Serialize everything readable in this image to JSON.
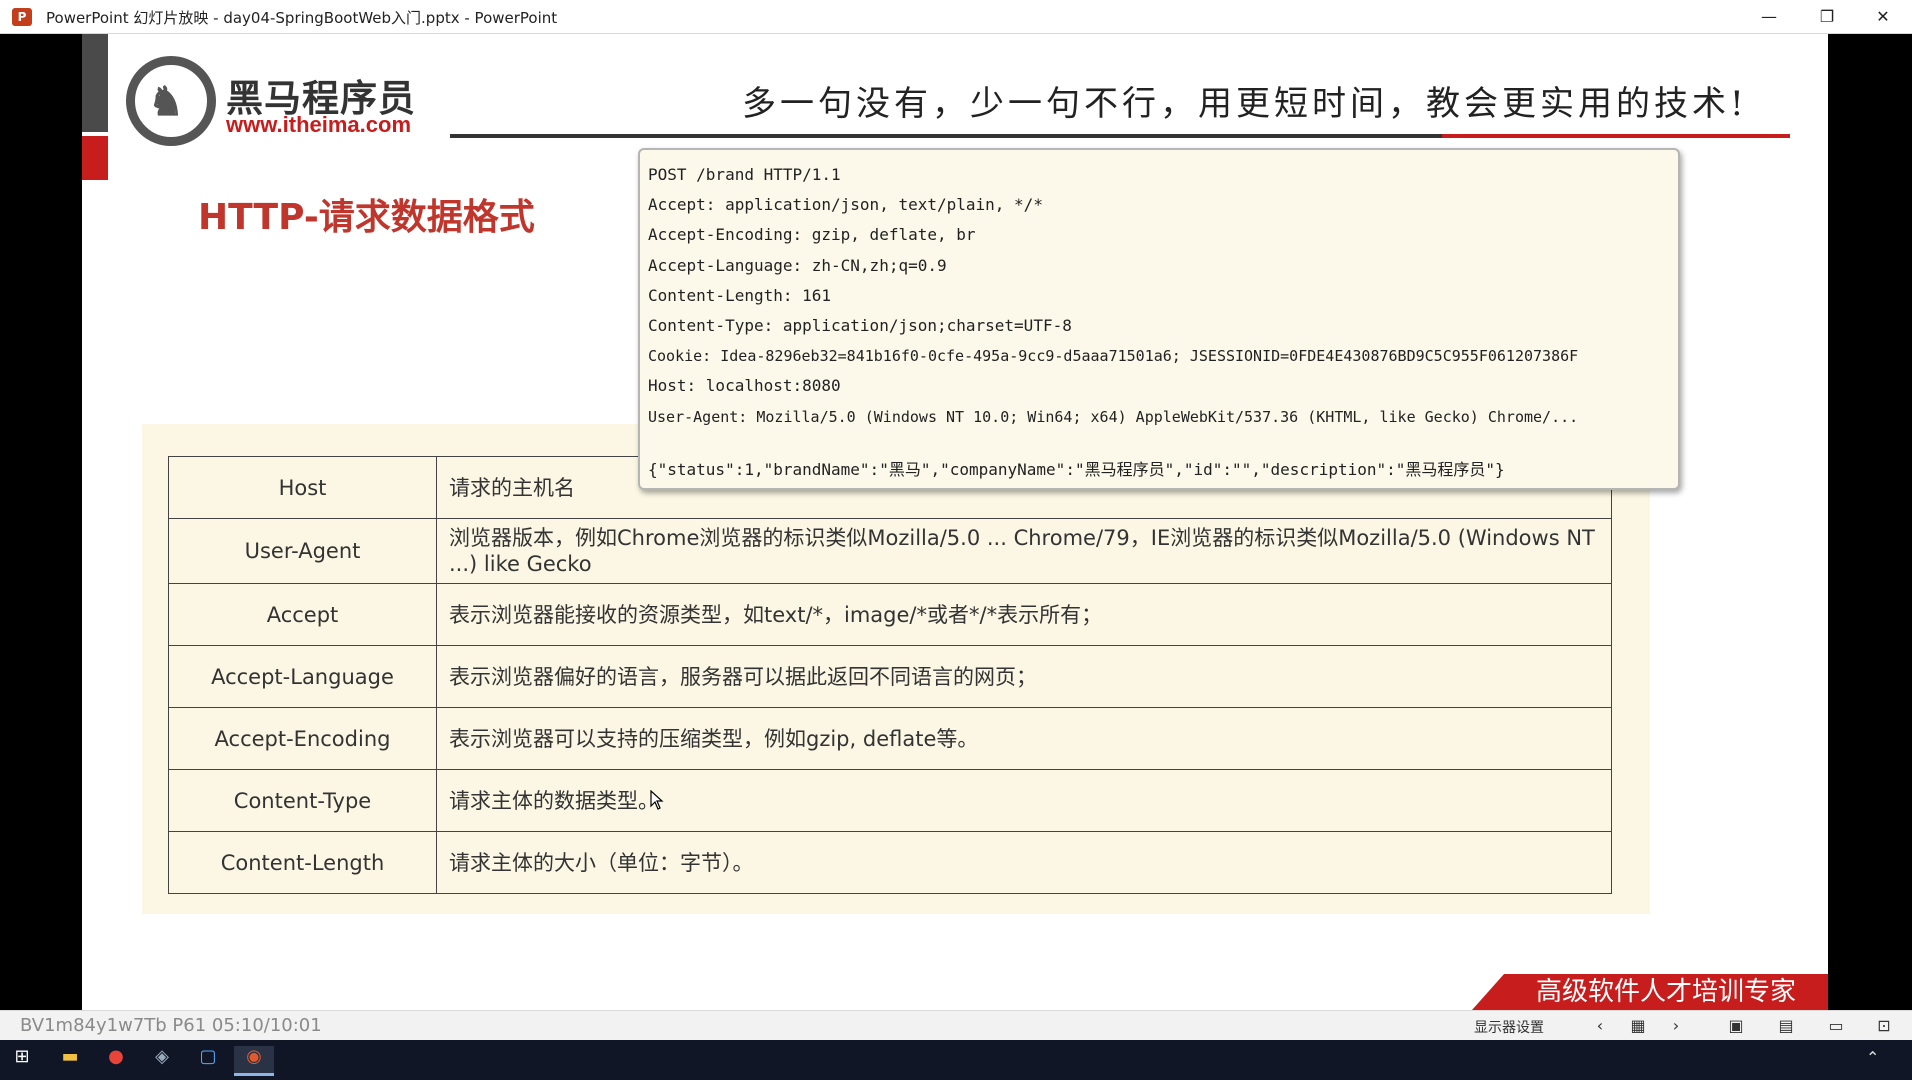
{
  "window": {
    "icon_letter": "P",
    "title": "PowerPoint 幻灯片放映  -  day04-SpringBootWeb入门.pptx - PowerPoint",
    "minimize": "—",
    "maximize": "❐",
    "close": "✕"
  },
  "slide": {
    "logo_cn": "黑马程序员",
    "logo_url": "www.itheima.com",
    "slogan": "多一句没有，少一句不行，用更短时间，教会更实用的技术!",
    "title": "HTTP-请求数据格式",
    "headers_table": [
      {
        "name": "Host",
        "desc": "请求的主机名"
      },
      {
        "name": "User-Agent",
        "desc": "浏览器版本，例如Chrome浏览器的标识类似Mozilla/5.0 ... Chrome/79，IE浏览器的标识类似Mozilla/5.0 (Windows NT ...) like Gecko"
      },
      {
        "name": "Accept",
        "desc": "表示浏览器能接收的资源类型，如text/*，image/*或者*/*表示所有；"
      },
      {
        "name": "Accept-Language",
        "desc": "表示浏览器偏好的语言，服务器可以据此返回不同语言的网页；"
      },
      {
        "name": "Accept-Encoding",
        "desc": "表示浏览器可以支持的压缩类型，例如gzip, deflate等。"
      },
      {
        "name": "Content-Type",
        "desc": "请求主体的数据类型。"
      },
      {
        "name": "Content-Length",
        "desc": "请求主体的大小（单位：字节）。"
      }
    ],
    "request_lines": [
      "POST /brand HTTP/1.1",
      "Accept: application/json, text/plain, */*",
      "Accept-Encoding: gzip, deflate, br",
      "Accept-Language: zh-CN,zh;q=0.9",
      "Content-Length: 161",
      "Content-Type: application/json;charset=UTF-8",
      "Cookie: Idea-8296eb32=841b16f0-0cfe-495a-9cc9-d5aaa71501a6; JSESSIONID=0FDE4E430876BD9C5C955F061207386F",
      "Host: localhost:8080",
      "User-Agent: Mozilla/5.0 (Windows NT 10.0; Win64; x64) AppleWebKit/537.36 (KHTML, like Gecko) Chrome/..."
    ],
    "request_body": "{\"status\":1,\"brandName\":\"黑马\",\"companyName\":\"黑马程序员\",\"id\":\"\",\"description\":\"黑马程序员\"}",
    "banner": "高级软件人才培训专家"
  },
  "statusbar": {
    "overlay_text": "BV1m84y1w7Tb P61 05:10/10:01",
    "display_settings": "显示器设置",
    "prev": "‹",
    "next": "›"
  },
  "colors": {
    "brand_red": "#c71d1d",
    "title_red": "#c0362c",
    "table_bg": "#fbf7e4"
  }
}
